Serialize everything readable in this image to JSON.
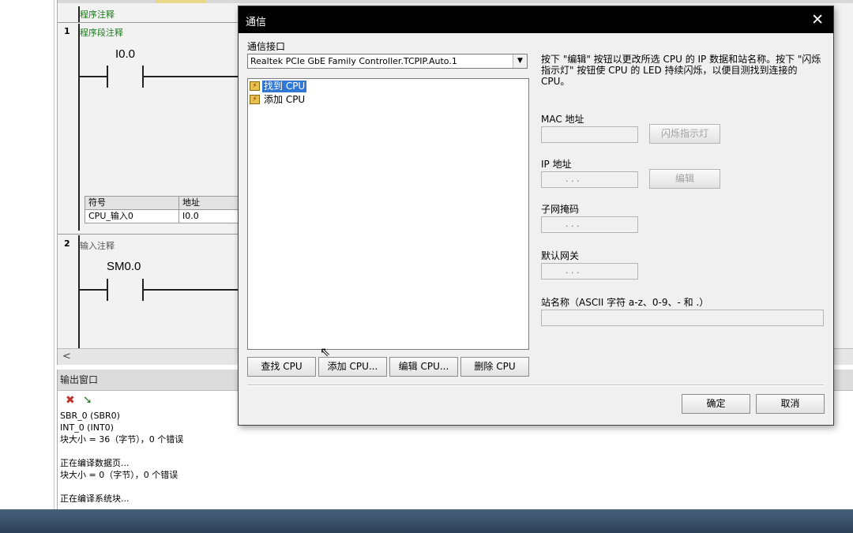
{
  "editor": {
    "network0": {
      "comment": "程序注释"
    },
    "network1": {
      "number": "1",
      "comment": "程序段注释",
      "contact": "I0.0"
    },
    "network2": {
      "number": "2",
      "comment": "输入注释",
      "contact": "SM0.0"
    },
    "symbol_table": {
      "headers": [
        "符号",
        "地址"
      ],
      "rows": [
        [
          "CPU_输入0",
          "I0.0"
        ]
      ]
    },
    "scroll_left": "<"
  },
  "output": {
    "title": "输出窗口",
    "lines": [
      "SBR_0 (SBR0)",
      "INT_0 (INT0)",
      "块大小 = 36（字节），0 个错误",
      "",
      "正在编译数据页...",
      "块大小 = 0（字节），0 个错误",
      "",
      "正在编译系统块..."
    ]
  },
  "dialog": {
    "title": "通信",
    "close": "✕",
    "interface_label": "通信接口",
    "interface_value": "Realtek PCIe GbE Family Controller.TCPIP.Auto.1",
    "tree": [
      "找到 CPU",
      "添加 CPU"
    ],
    "buttons": {
      "find": "查找 CPU",
      "add": "添加 CPU...",
      "edit": "编辑 CPU...",
      "delete": "删除 CPU",
      "flash": "闪烁指示灯",
      "edit_ip": "编辑",
      "ok": "确定",
      "cancel": "取消"
    },
    "help_text": "按下 \"编辑\" 按钮以更改所选 CPU 的 IP 数据和站名称。按下 \"闪烁指示灯\" 按钮使 CPU 的 LED 持续闪烁，以便目测找到连接的 CPU。",
    "mac_label": "MAC 地址",
    "ip_label": "IP 地址",
    "subnet_label": "子网掩码",
    "gateway_label": "默认网关",
    "station_label": "站名称（ASCII 字符 a-z、0-9、- 和 .）",
    "ip_placeholder": ".        .        ."
  }
}
